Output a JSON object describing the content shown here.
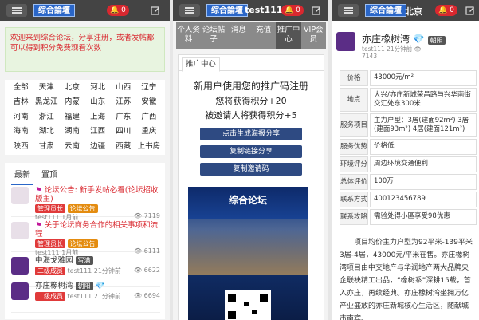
{
  "panel1": {
    "logo": "综合論壇",
    "notify_count": "0",
    "notice": "欢迎来到综合论坛，分享注册，或者发帖都可以得到积分免费观看次数",
    "cities": [
      "全部",
      "天津",
      "北京",
      "河北",
      "山西",
      "辽宁",
      "吉林",
      "黑龙江",
      "内蒙",
      "山东",
      "江苏",
      "安徽",
      "河南",
      "浙江",
      "福建",
      "上海",
      "广东",
      "广西",
      "海南",
      "湖北",
      "湖南",
      "江西",
      "四川",
      "重庆",
      "陕西",
      "甘肃",
      "云南",
      "边疆",
      "西藏",
      "上书房"
    ],
    "tabs": [
      "最新",
      "置顶"
    ],
    "items": [
      {
        "title": "论坛公告: 新手发帖必看(论坛招收版主)",
        "badge1": "管理员长",
        "badge2": "论坛公告",
        "user": "test111",
        "time": "1月前",
        "views": "7119"
      },
      {
        "title": "关于论坛商务合作的相关事项和流程",
        "badge1": "管理员长",
        "badge2": "论坛公告",
        "user": "test111",
        "time": "1月前",
        "views": "6111"
      },
      {
        "title": "中海戈雅园",
        "tag": "写满",
        "badge1": "二级成员",
        "user": "test111",
        "time": "21分钟前",
        "views": "6622"
      },
      {
        "title": "亦庄橡树湾",
        "tag": "朝阳",
        "badge1": "二级成员",
        "user": "test111",
        "time": "21分钟前",
        "views": "6694"
      }
    ]
  },
  "panel2": {
    "logo": "综合論壇",
    "title": "test111",
    "notify_count": "0",
    "tabs": [
      "个人资料",
      "论坛帖子",
      "消息",
      "充值",
      "推广中心",
      "VIP会员"
    ],
    "card_tab": "推广中心",
    "headline": "新用户使用您的推广码注册",
    "line1": "您将获得积分+20",
    "line2": "被邀请人将获得积分+5",
    "buttons": [
      "点击生成海报分享",
      "复制链接分享",
      "复制邀请码"
    ],
    "poster_title": "综合论坛"
  },
  "panel3": {
    "logo": "综合論壇",
    "title": "北京",
    "notify_count": "0",
    "post_title": "亦庄橡树湾",
    "post_tag": "朝阳",
    "post_user": "test111",
    "post_time": "21分钟前",
    "post_views": "7143",
    "rows": [
      {
        "k": "价格",
        "v": "43000元/m²"
      },
      {
        "k": "地点",
        "v": "大兴/亦庄新城荣昌路与兴华南街交汇处东300米"
      },
      {
        "k": "服务项目",
        "v": "主力户型：3居(建面92m²) 3居(建面93m²) 4居(建面121m²)"
      },
      {
        "k": "服务优势",
        "v": "价格低"
      },
      {
        "k": "环境评分",
        "v": "周边环境交通便利"
      },
      {
        "k": "总体评价",
        "v": "100万"
      },
      {
        "k": "联系方式",
        "v": "400123456789"
      },
      {
        "k": "联系攻略",
        "v": "需验处得小區享受98优惠"
      }
    ],
    "paragraph": "项目均价主力户型为92平米-139平米3居-4居，43000元/平米在售。亦庄橡树湾项目由中交地产与华润地产两大品牌央企联袂精工出品，“橡树系”深耕15载，首入亦庄，再续经典。亦庄橡树湾坐拥万亿产业盛放的亦庄新城核心生活区，随献城市南宾。"
  }
}
